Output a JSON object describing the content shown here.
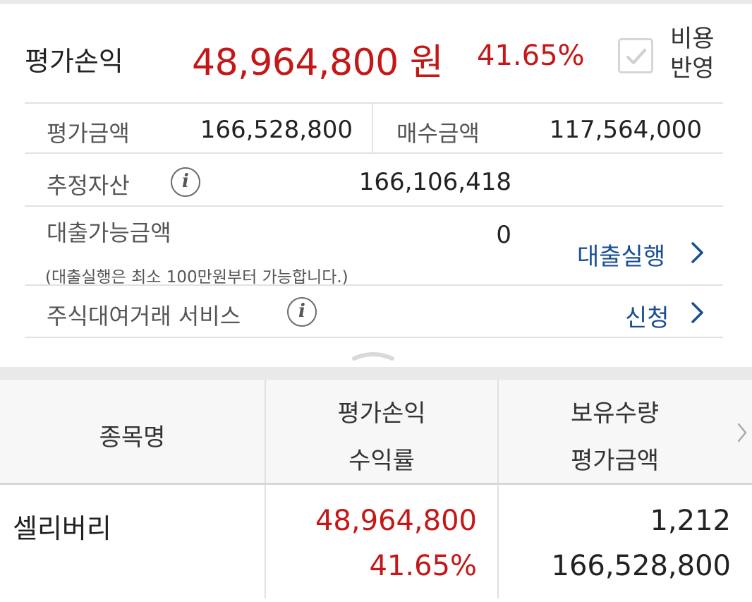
{
  "summary": {
    "pl_label": "평가손익",
    "pl_amount": "48,964,800 원",
    "pl_rate": "41.65%",
    "cost_reflect": {
      "line1": "비용",
      "line2": "반영",
      "checked": true
    },
    "eval_amount_label": "평가금액",
    "eval_amount_value": "166,528,800",
    "buy_amount_label": "매수금액",
    "buy_amount_value": "117,564,000",
    "est_asset_label": "추정자산",
    "est_asset_value": "166,106,418",
    "loan_label": "대출가능금액",
    "loan_value": "0",
    "loan_note": "(대출실행은 최소 100만원부터 가능합니다.)",
    "loan_action": "대출실행",
    "lending_label": "주식대여거래 서비스",
    "lending_action": "신청"
  },
  "table": {
    "col1": "종목명",
    "col2_line1": "평가손익",
    "col2_line2": "수익률",
    "col3_line1": "보유수량",
    "col3_line2": "평가금액",
    "rows": [
      {
        "name": "셀리버리",
        "pl": "48,964,800",
        "rate": "41.65%",
        "qty": "1,212",
        "eval": "166,528,800"
      }
    ]
  },
  "colors": {
    "loss_profit_red": "#c51717",
    "link_blue": "#1a4f93"
  },
  "icons": [
    "check-icon",
    "info-icon",
    "chevron-right-icon",
    "collapse-grip-icon"
  ]
}
